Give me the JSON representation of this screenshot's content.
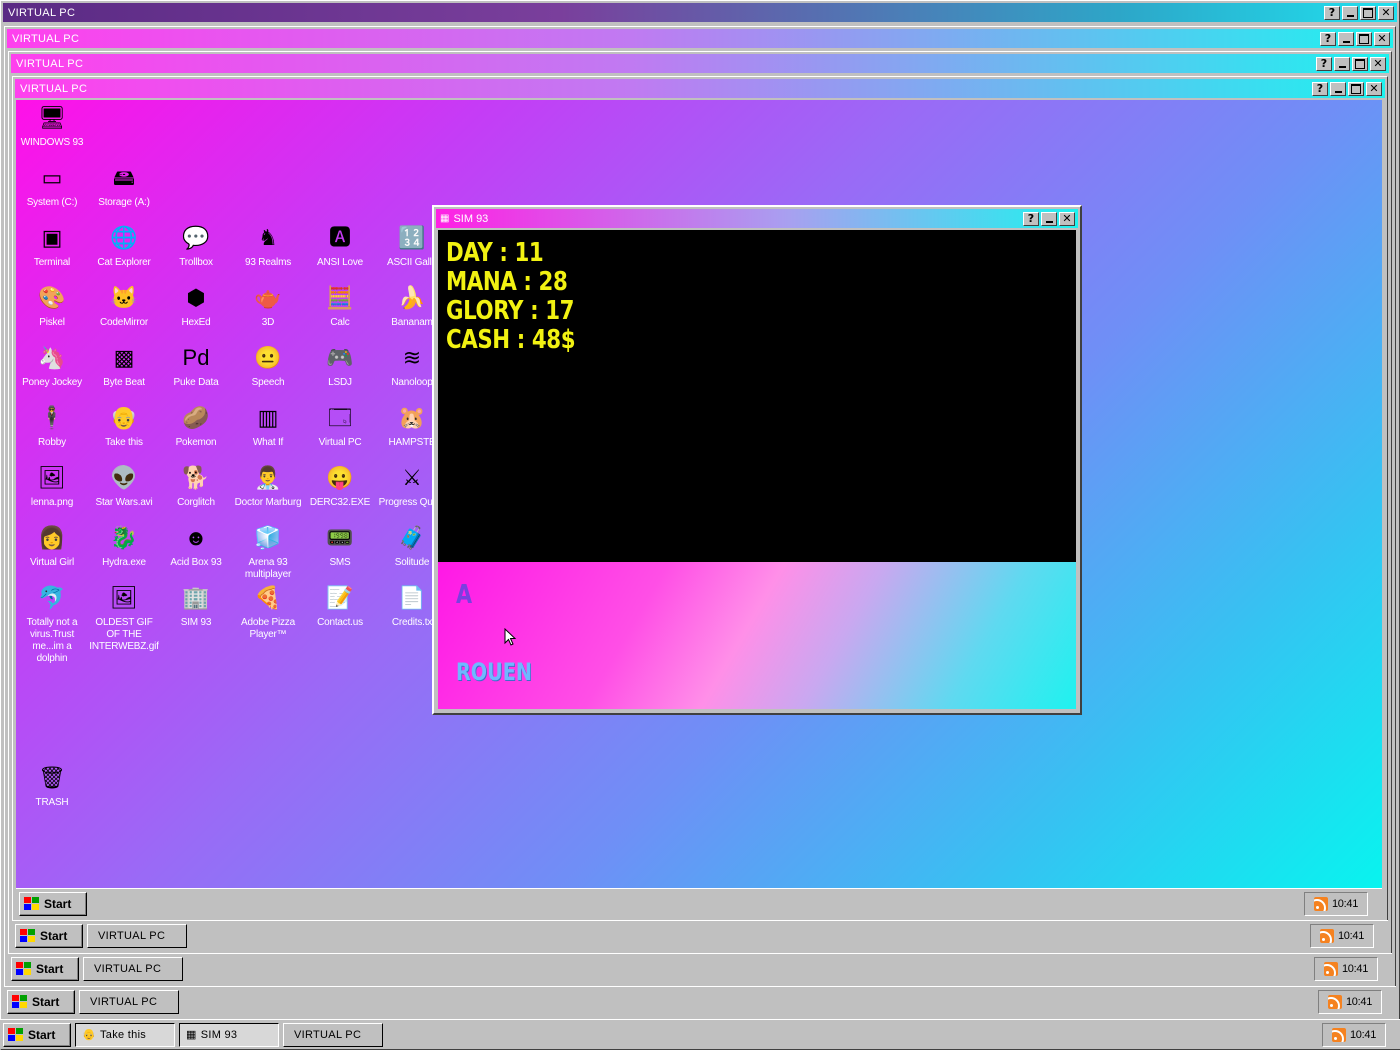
{
  "windows": [
    {
      "title": "VIRTUAL PC",
      "help": "?"
    },
    {
      "title": "VIRTUAL PC",
      "help": "?"
    },
    {
      "title": "VIRTUAL PC",
      "help": "?"
    },
    {
      "title": "VIRTUAL PC",
      "help": "?"
    }
  ],
  "desktop_icons": [
    {
      "label": "WINDOWS 93",
      "icon": "computer-icon",
      "glyph": "🖥"
    },
    {
      "label": "System (C:)",
      "icon": "drive-icon",
      "glyph": "▭"
    },
    {
      "label": "Storage (A:)",
      "icon": "floppy-drive-icon",
      "glyph": "🖴"
    },
    {
      "label": "Terminal",
      "icon": "terminal-icon",
      "glyph": "▣"
    },
    {
      "label": "Cat Explorer",
      "icon": "globe-icon",
      "glyph": "🌐"
    },
    {
      "label": "Trollbox",
      "icon": "chat-icon",
      "glyph": "💬"
    },
    {
      "label": "93 Realms",
      "icon": "knight-icon",
      "glyph": "♞"
    },
    {
      "label": "ANSI Love",
      "icon": "text-editor-icon",
      "glyph": "🅰"
    },
    {
      "label": "ASCII Galle",
      "icon": "numbers-icon",
      "glyph": "🔢"
    },
    {
      "label": "Piskel",
      "icon": "palette-icon",
      "glyph": "🎨"
    },
    {
      "label": "CodeMirror",
      "icon": "codemirror-icon",
      "glyph": "🐱"
    },
    {
      "label": "HexEd",
      "icon": "cube-icon",
      "glyph": "⬢"
    },
    {
      "label": "3D",
      "icon": "teapot-icon",
      "glyph": "🫖"
    },
    {
      "label": "Calc",
      "icon": "calculator-icon",
      "glyph": "🧮"
    },
    {
      "label": "Bananam",
      "icon": "banana-icon",
      "glyph": "🍌"
    },
    {
      "label": "Poney Jockey",
      "icon": "pony-icon",
      "glyph": "🦄"
    },
    {
      "label": "Byte Beat",
      "icon": "bytebeat-icon",
      "glyph": "▩"
    },
    {
      "label": "Puke Data",
      "icon": "pd-icon",
      "glyph": "Pd"
    },
    {
      "label": "Speech",
      "icon": "face-icon",
      "glyph": "😐"
    },
    {
      "label": "LSDJ",
      "icon": "gameboy-icon",
      "glyph": "🎮"
    },
    {
      "label": "Nanoloop",
      "icon": "wave-icon",
      "glyph": "≋"
    },
    {
      "label": "Robby",
      "icon": "stickman-icon",
      "glyph": "🕴"
    },
    {
      "label": "Take this",
      "icon": "oldman-icon",
      "glyph": "👴"
    },
    {
      "label": "Pokemon",
      "icon": "pokeball-icon",
      "glyph": "🥔"
    },
    {
      "label": "What If",
      "icon": "barcode-icon",
      "glyph": "▥"
    },
    {
      "label": "Virtual PC",
      "icon": "virtual-pc-icon",
      "glyph": "🗔"
    },
    {
      "label": "HAMPSTE",
      "icon": "hamster-icon",
      "glyph": "🐹"
    },
    {
      "label": "lenna.png",
      "icon": "image-file-icon",
      "glyph": "🖼"
    },
    {
      "label": "Star Wars.avi",
      "icon": "yoda-icon",
      "glyph": "👽"
    },
    {
      "label": "Corglitch",
      "icon": "corgi-icon",
      "glyph": "🐕"
    },
    {
      "label": "Doctor Marburg",
      "icon": "doctor-icon",
      "glyph": "👨‍⚕"
    },
    {
      "label": "DERC32.EXE",
      "icon": "face-screen-icon",
      "glyph": "😛"
    },
    {
      "label": "Progress Quest",
      "icon": "swords-icon",
      "glyph": "⚔"
    },
    {
      "label": "Virtual Girl",
      "icon": "girl-icon",
      "glyph": "👩"
    },
    {
      "label": "Hydra.exe",
      "icon": "hydra-icon",
      "glyph": "🐉"
    },
    {
      "label": "Acid Box 93",
      "icon": "smiley-icon",
      "glyph": "☻"
    },
    {
      "label": "Arena 93 multiplayer",
      "icon": "cube3d-icon",
      "glyph": "🧊"
    },
    {
      "label": "SMS",
      "icon": "phone-icon",
      "glyph": "📟"
    },
    {
      "label": "Solitude",
      "icon": "game-icon",
      "glyph": "🧳"
    },
    {
      "label": "Totally not a virus.Trust me...im a dolphin",
      "icon": "dolphin-icon",
      "glyph": "🐬"
    },
    {
      "label": "OLDEST GIF OF THE INTERWEBZ.gif",
      "icon": "gif-file-icon",
      "glyph": "🖼"
    },
    {
      "label": "SIM 93",
      "icon": "sim93-icon",
      "glyph": "🏢"
    },
    {
      "label": "Adobe Pizza Player™",
      "icon": "pizza-icon",
      "glyph": "🍕"
    },
    {
      "label": "Contact.us",
      "icon": "contact-icon",
      "glyph": "📝"
    },
    {
      "label": "Credits.tx",
      "icon": "text-file-icon",
      "glyph": "📄"
    },
    {
      "label": "TRASH",
      "icon": "trash-icon",
      "glyph": "🗑"
    }
  ],
  "sim": {
    "title": "SIM 93",
    "help": "?",
    "stats": [
      "DAY : 11",
      "MANA : 28",
      "GLORY : 17",
      "CASH : 48$"
    ],
    "letter": "A",
    "city": "ROUEN"
  },
  "taskbars": [
    {
      "start": "Start",
      "tasks": [],
      "clock": "10:41"
    },
    {
      "start": "Start",
      "tasks": [
        "VIRTUAL PC"
      ],
      "clock": "10:41"
    },
    {
      "start": "Start",
      "tasks": [
        "VIRTUAL PC"
      ],
      "clock": "10:41"
    },
    {
      "start": "Start",
      "tasks": [
        "VIRTUAL PC"
      ],
      "clock": "10:41"
    },
    {
      "start": "Start",
      "tasks": [
        "Take this",
        "SIM 93",
        "VIRTUAL PC"
      ],
      "clock": "10:41"
    }
  ],
  "colors": {
    "title1": "#6b2b8a",
    "title2": "#1ef2ef",
    "stat_yellow": "#f2f212",
    "desktop_pink": "#ff10e8",
    "desktop_cyan": "#08f4ef"
  }
}
